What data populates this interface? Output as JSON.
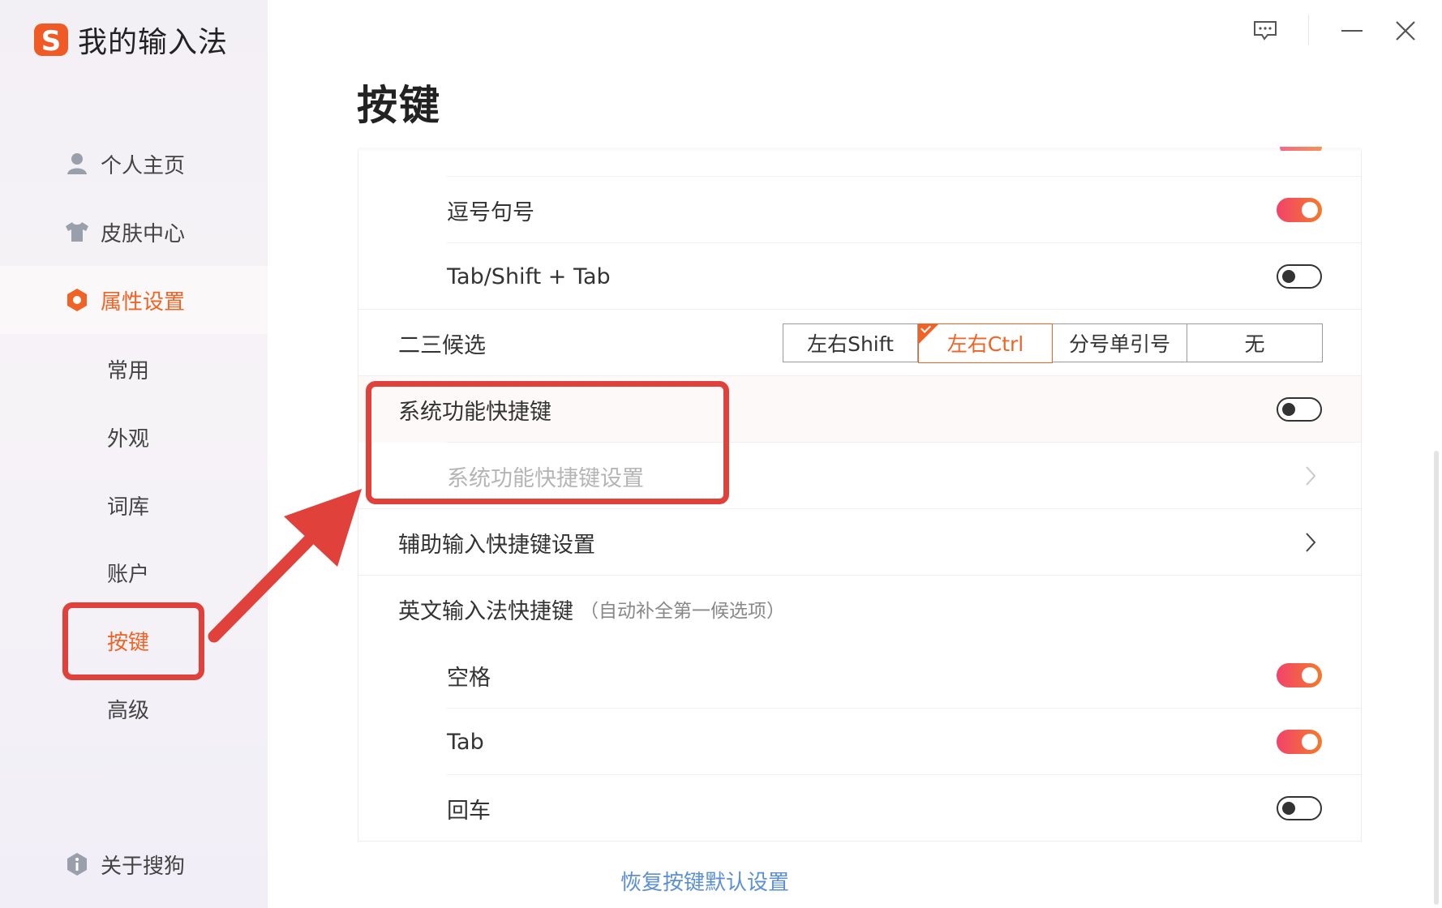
{
  "app": {
    "brand_title": "我的输入法",
    "logo_icon": "sogou-s-logo",
    "accent_color": "#f06324"
  },
  "window": {
    "feedback_icon": "feedback-icon",
    "minimize_icon": "minimize-icon",
    "close_icon": "close-icon"
  },
  "sidebar": {
    "items": [
      {
        "label": "个人主页",
        "icon": "user-icon"
      },
      {
        "label": "皮肤中心",
        "icon": "tshirt-icon"
      },
      {
        "label": "属性设置",
        "icon": "hexagon-settings-icon",
        "active": true
      }
    ],
    "subitems": [
      {
        "label": "常用"
      },
      {
        "label": "外观"
      },
      {
        "label": "词库"
      },
      {
        "label": "账户"
      },
      {
        "label": "按键",
        "active": true
      },
      {
        "label": "高级"
      }
    ],
    "about": {
      "label": "关于搜狗",
      "icon": "info-icon"
    }
  },
  "main": {
    "title": "按键",
    "rows": {
      "comma_period": {
        "label": "逗号句号",
        "enabled": true
      },
      "tab_shift_tab": {
        "label": "Tab/Shift + Tab",
        "enabled": false
      },
      "second_third_candidate": {
        "label": "二三候选",
        "options": [
          "左右Shift",
          "左右Ctrl",
          "分号单引号",
          "无"
        ],
        "selected": "左右Ctrl"
      },
      "system_shortcuts": {
        "label": "系统功能快捷键",
        "enabled": false
      },
      "system_shortcuts_settings": {
        "label": "系统功能快捷键设置"
      },
      "assist_input_shortcuts": {
        "label": "辅助输入快捷键设置"
      },
      "english_ime_shortcuts": {
        "label": "英文输入法快捷键",
        "note": "（自动补全第一候选项）"
      },
      "space": {
        "label": "空格",
        "enabled": true
      },
      "tab": {
        "label": "Tab",
        "enabled": true
      },
      "enter": {
        "label": "回车",
        "enabled": false
      }
    },
    "restore_link": "恢复按键默认设置"
  },
  "annotations": {
    "highlight_color": "#e0423b"
  }
}
